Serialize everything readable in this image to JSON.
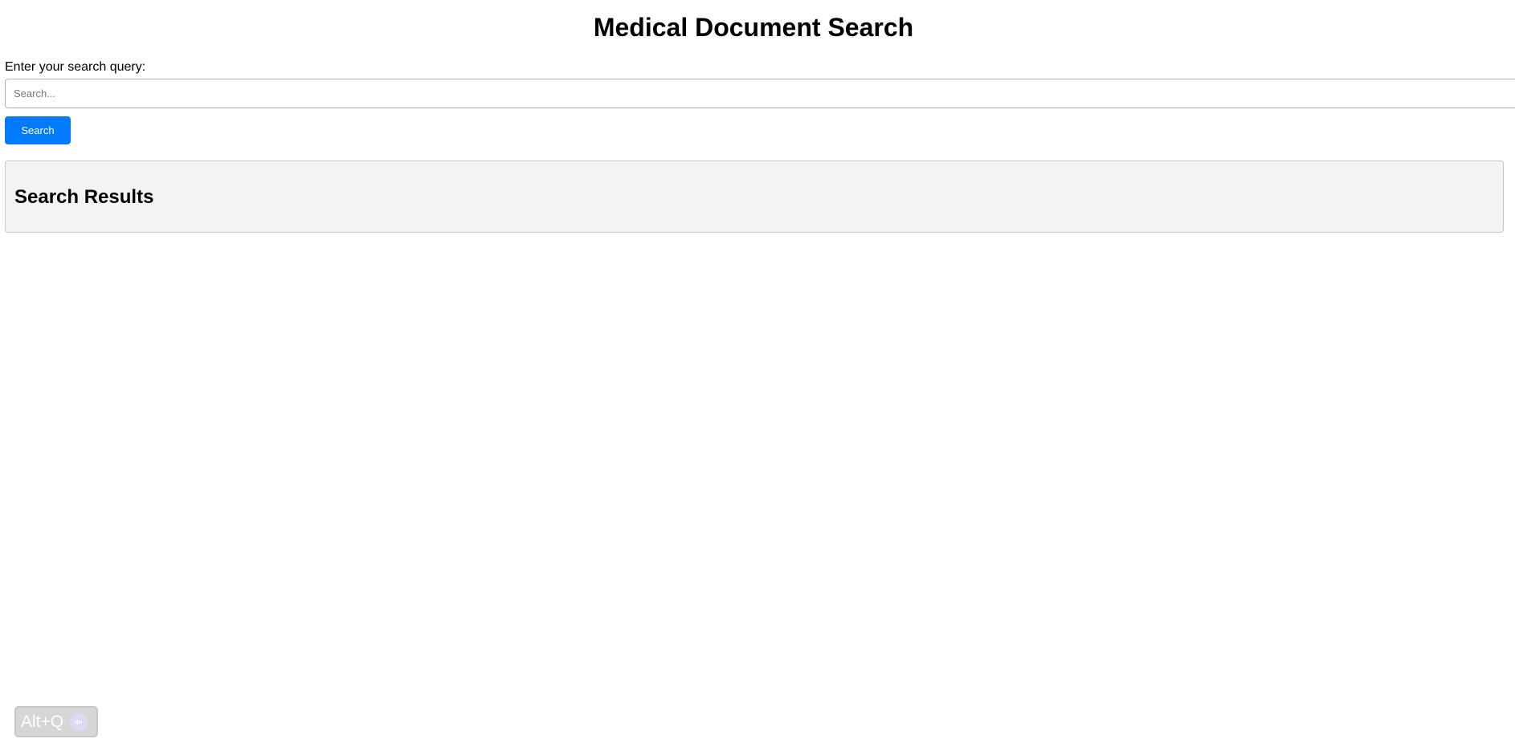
{
  "page": {
    "title": "Medical Document Search"
  },
  "search": {
    "label": "Enter your search query:",
    "placeholder": "Search...",
    "value": "",
    "button_label": "Search"
  },
  "results": {
    "heading": "Search Results"
  },
  "shortcut": {
    "label": "Alt+Q",
    "icon": "audio-wave-icon"
  },
  "colors": {
    "accent": "#007bff",
    "panel_background": "#f3f3f3"
  }
}
